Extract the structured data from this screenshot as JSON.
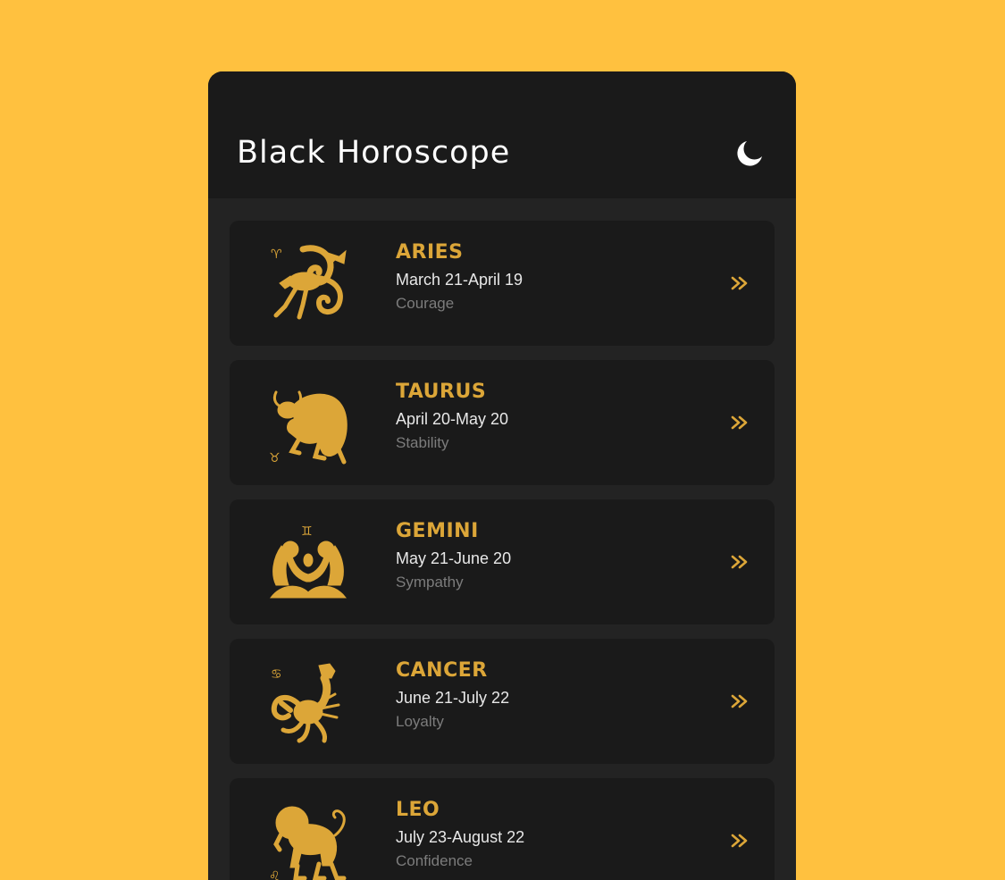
{
  "app": {
    "title": "Black Horoscope",
    "theme_icon": "moon-icon"
  },
  "colors": {
    "background": "#FFC13F",
    "header": "#1A1A1A",
    "screen": "#232323",
    "card": "#1A1A1A",
    "accent": "#DCA638",
    "text_primary": "#E8E8E8",
    "text_secondary": "#7C7C7C"
  },
  "signs": [
    {
      "name": "ARIES",
      "dates": "March 21-April 19",
      "trait": "Courage",
      "icon": "aries-ram-icon",
      "action_icon": "double-chevron-right-icon"
    },
    {
      "name": "TAURUS",
      "dates": "April 20-May 20",
      "trait": "Stability",
      "icon": "taurus-bull-icon",
      "action_icon": "double-chevron-right-icon"
    },
    {
      "name": "GEMINI",
      "dates": "May 21-June 20",
      "trait": "Sympathy",
      "icon": "gemini-twins-icon",
      "action_icon": "double-chevron-right-icon"
    },
    {
      "name": "CANCER",
      "dates": "June 21-July 22",
      "trait": "Loyalty",
      "icon": "cancer-crab-icon",
      "action_icon": "double-chevron-right-icon"
    },
    {
      "name": "LEO",
      "dates": "July 23-August 22",
      "trait": "Confidence",
      "icon": "leo-lion-icon",
      "action_icon": "double-chevron-right-icon"
    }
  ]
}
